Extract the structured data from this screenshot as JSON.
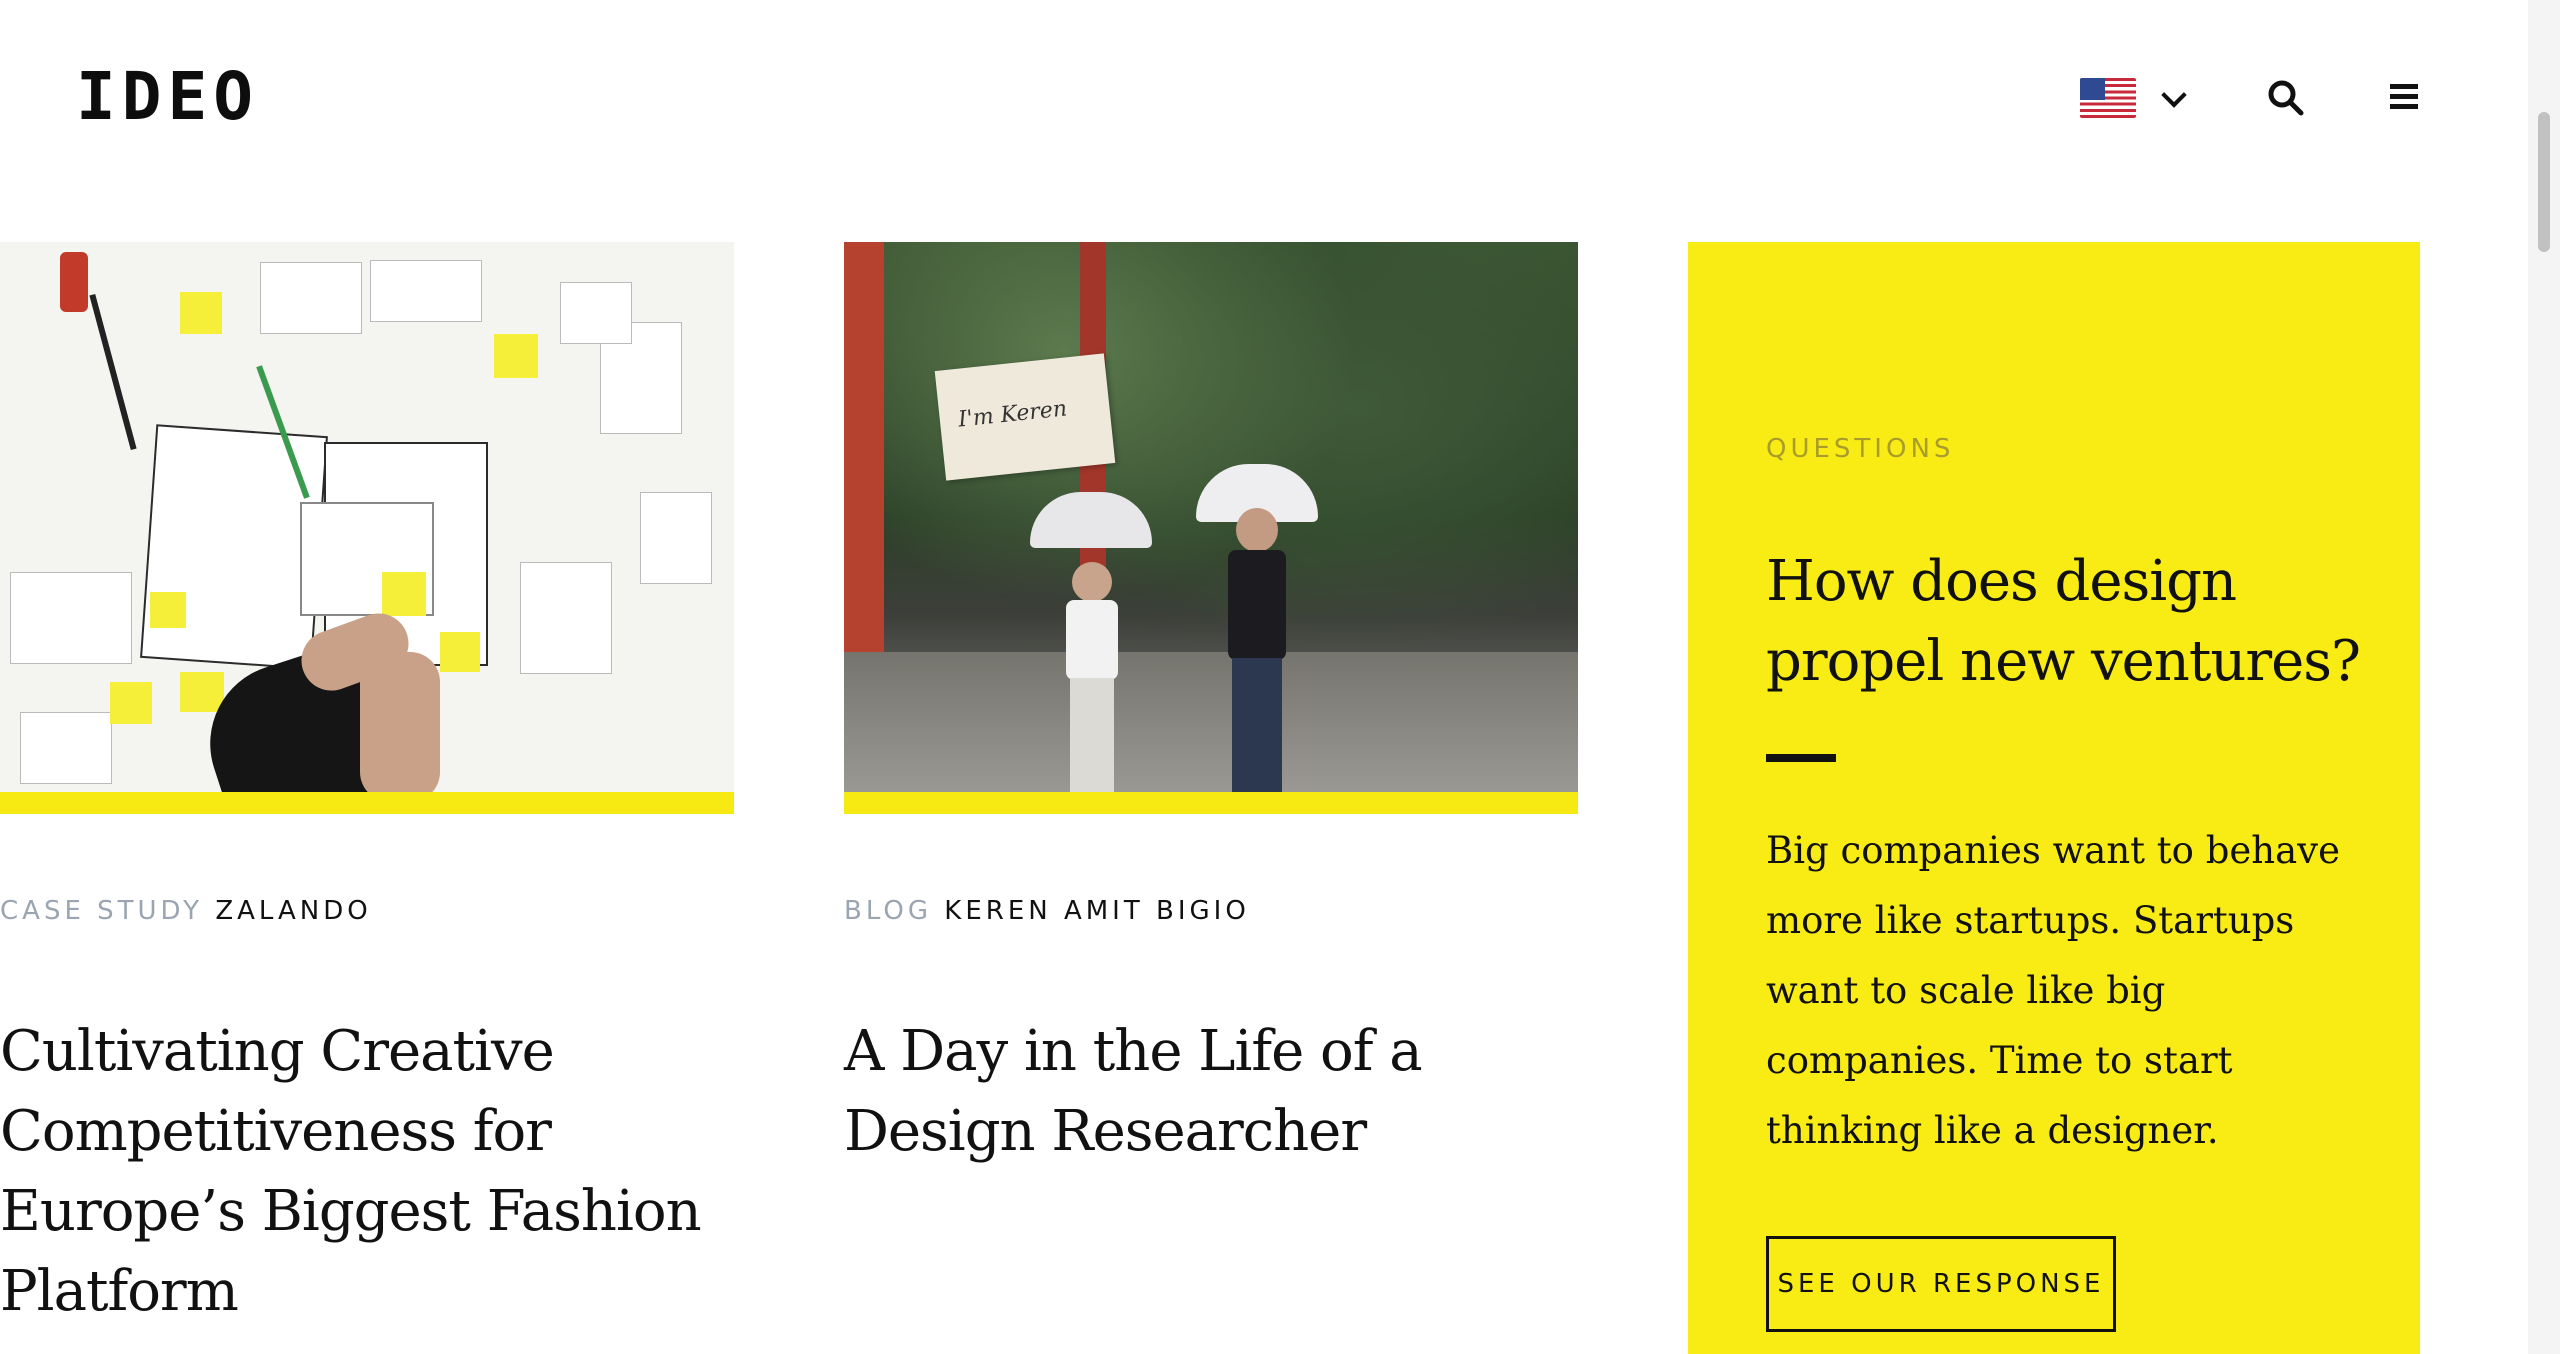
{
  "header": {
    "logo": "IDEO",
    "locale_icon": "us-flag-icon",
    "dropdown_icon": "chevron-down-icon",
    "search_icon": "search-icon",
    "menu_icon": "hamburger-menu-icon"
  },
  "cards": [
    {
      "kind": "CASE STUDY",
      "who": "ZALANDO",
      "title": "Cultivating Creative Competitiveness for Europe’s Biggest Fashion Platform",
      "image": "workshop-table-photo"
    },
    {
      "kind": "BLOG",
      "who": "KEREN AMIT BIGIO",
      "title": "A Day in the Life of a Design Researcher",
      "image": "umbrellas-forest-photo",
      "sign_text": "I'm Keren"
    }
  ],
  "panel": {
    "kicker": "QUESTIONS",
    "title": "How does design propel new ventures?",
    "body": "Big companies want to behave more like startups. Startups want to scale like big companies. Time to start thinking like a designer.",
    "button": "SEE OUR RESPONSE"
  },
  "colors": {
    "accent_yellow": "#f9ec15",
    "meta_gray": "#9aa5b1",
    "text": "#111111"
  }
}
